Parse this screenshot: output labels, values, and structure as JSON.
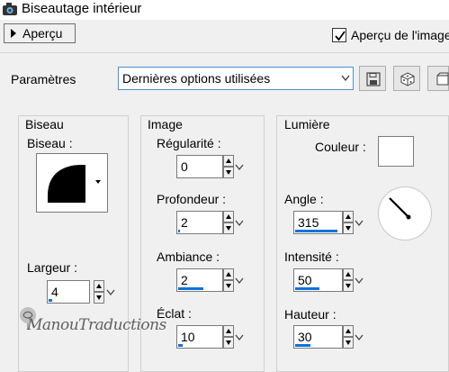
{
  "window": {
    "title": "Biseautage intérieur",
    "icon": "camera-icon"
  },
  "toolbar": {
    "preview_label": "Aperçu",
    "preview_checkbox_label": "Aperçu de l'image",
    "preview_checked": true
  },
  "params": {
    "label": "Paramètres",
    "preset_value": "Dernières options utilisées",
    "buttons": [
      "save-icon",
      "random-dice-icon",
      "reset-icon"
    ]
  },
  "bevel_group": {
    "title": "Biseau",
    "bevel_label": "Biseau :",
    "width_label": "Largeur :",
    "width_value": "4",
    "width_fill": 0.08
  },
  "image_group": {
    "title": "Image",
    "regularity": {
      "label": "Régularité :",
      "value": "0",
      "fill": 0.0
    },
    "depth": {
      "label": "Profondeur :",
      "value": "2",
      "fill": 0.03
    },
    "ambiance": {
      "label": "Ambiance :",
      "value": "2",
      "fill": 0.55
    },
    "shine": {
      "label": "Éclat :",
      "value": "10",
      "fill": 0.1
    }
  },
  "light_group": {
    "title": "Lumière",
    "color_label": "Couleur :",
    "color_value": "#ffffff",
    "angle": {
      "label": "Angle :",
      "value": "315",
      "fill": 0.88
    },
    "intensity": {
      "label": "Intensité :",
      "value": "50",
      "fill": 0.5
    },
    "height": {
      "label": "Hauteur :",
      "value": "30",
      "fill": 0.33
    }
  },
  "watermark": {
    "text": "ManouTraductions"
  },
  "colors": {
    "accent": "#0a74d9",
    "select_border": "#4a8fd8"
  }
}
